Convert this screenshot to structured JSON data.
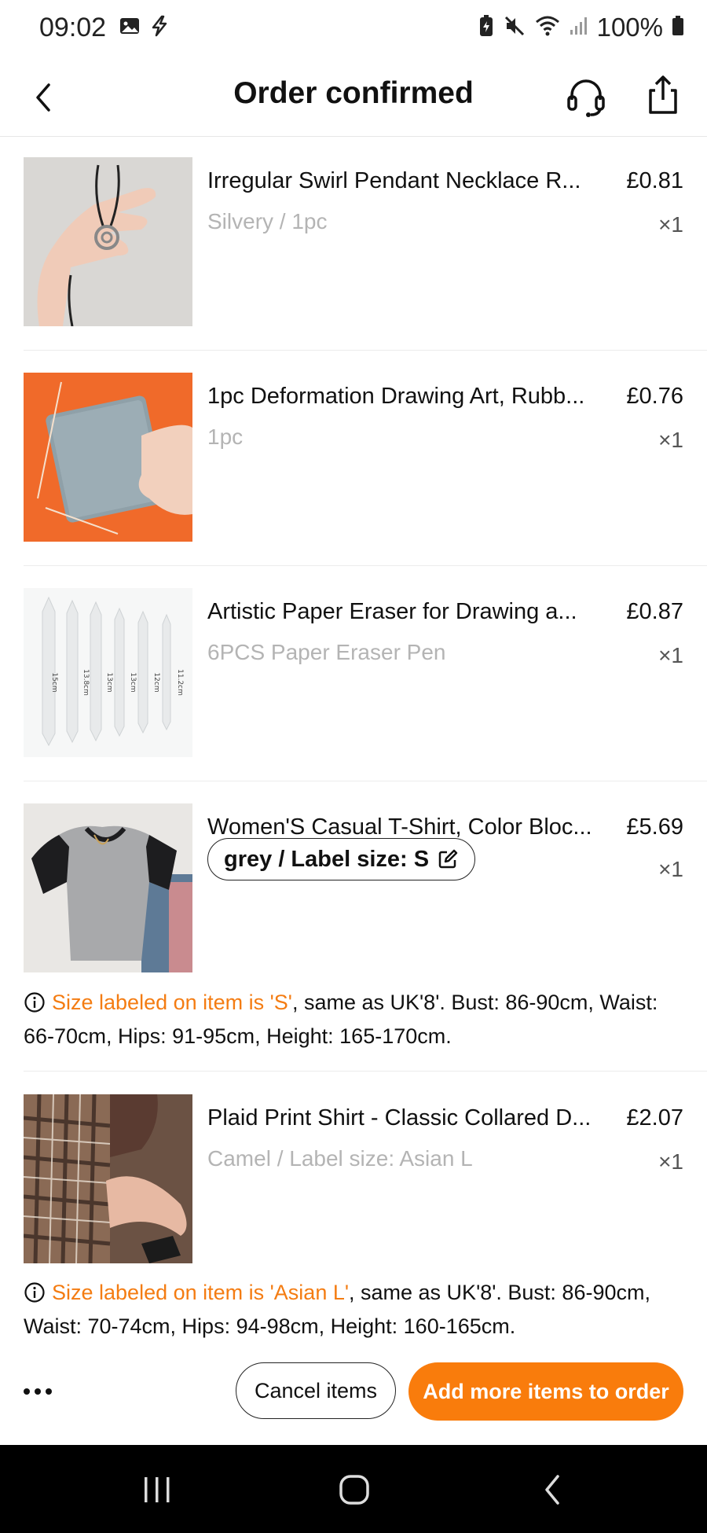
{
  "status_bar": {
    "time": "09:02",
    "battery": "100%"
  },
  "header": {
    "title": "Order confirmed"
  },
  "items": [
    {
      "name": "Irregular Swirl Pendant Necklace R...",
      "variant": "Silvery / 1pc",
      "price": "£0.81",
      "qty": "×1"
    },
    {
      "name": "1pc Deformation Drawing Art, Rubb...",
      "variant": "1pc",
      "price": "£0.76",
      "qty": "×1"
    },
    {
      "name": "Artistic Paper Eraser for Drawing a...",
      "variant": "6PCS Paper Eraser Pen",
      "price": "£0.87",
      "qty": "×1",
      "image_labels": [
        "15cm",
        "13.8cm",
        "13cm",
        "13cm",
        "12cm",
        "11.2cm"
      ]
    },
    {
      "name": "Women'S Casual T-Shirt, Color Bloc...",
      "variant": "grey / Label size: S",
      "price": "£5.69",
      "qty": "×1",
      "size_note": {
        "highlight": "Size labeled on item is 'S'",
        "rest": ", same as UK'8'. Bust: 86-90cm, Waist: 66-70cm, Hips: 91-95cm, Height: 165-170cm."
      }
    },
    {
      "name": "Plaid Print Shirt - Classic Collared D...",
      "variant": "Camel / Label size: Asian L",
      "price": "£2.07",
      "qty": "×1",
      "size_note": {
        "highlight": "Size labeled on item is 'Asian L'",
        "rest": ", same as UK'8'. Bust: 86-90cm, Waist: 70-74cm, Hips: 94-98cm, Height: 160-165cm."
      }
    }
  ],
  "actions": {
    "cancel_label": "Cancel items",
    "add_label": "Add more items to order"
  },
  "colors": {
    "accent": "#f97c0c",
    "note_highlight": "#f47c12",
    "muted_text": "#b4b4b4"
  },
  "icons": [
    "image-icon",
    "flash-icon",
    "battery-saver-icon",
    "mute-icon",
    "wifi-icon",
    "signal-icon",
    "battery-icon",
    "back-icon",
    "headset-icon",
    "share-icon",
    "edit-icon",
    "info-icon",
    "more-icon",
    "recents-icon",
    "home-icon",
    "nav-back-icon"
  ]
}
